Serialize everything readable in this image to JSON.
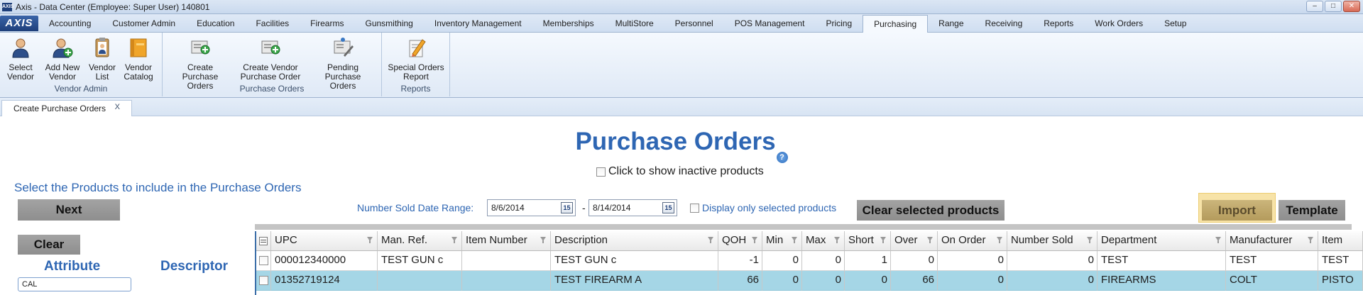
{
  "window": {
    "title": "Axis - Data Center  (Employee: Super User) 140801",
    "app_logo": "AXIS"
  },
  "ribbon": {
    "logo": "AXIS",
    "tabs": [
      "Accounting",
      "Customer Admin",
      "Education",
      "Facilities",
      "Firearms",
      "Gunsmithing",
      "Inventory Management",
      "Memberships",
      "MultiStore",
      "Personnel",
      "POS Management",
      "Pricing",
      "Purchasing",
      "Range",
      "Receiving",
      "Reports",
      "Work Orders",
      "Setup"
    ],
    "active_tab": "Purchasing",
    "groups": [
      {
        "label": "Vendor Admin",
        "buttons": [
          {
            "line1": "Select",
            "line2": "Vendor",
            "icon": "person-icon"
          },
          {
            "line1": "Add New",
            "line2": "Vendor",
            "icon": "person-add-icon"
          },
          {
            "line1": "Vendor",
            "line2": "List",
            "icon": "clipboard-person-icon"
          },
          {
            "line1": "Vendor",
            "line2": "Catalog",
            "icon": "catalog-book-icon"
          }
        ]
      },
      {
        "label": "Purchase Orders",
        "buttons": [
          {
            "line1": "Create Purchase",
            "line2": "Orders",
            "icon": "create-orders-icon"
          },
          {
            "line1": "Create Vendor",
            "line2": "Purchase Order",
            "icon": "vendor-order-icon"
          },
          {
            "line1": "Pending Purchase",
            "line2": "Orders",
            "icon": "pending-orders-icon"
          }
        ]
      },
      {
        "label": "Reports",
        "buttons": [
          {
            "line1": "Special Orders",
            "line2": "Report",
            "icon": "report-pencil-icon"
          }
        ]
      }
    ]
  },
  "doc_tab": {
    "label": "Create Purchase Orders",
    "close": "X"
  },
  "main": {
    "title": "Purchase Orders",
    "help": "?",
    "inactive_label": "Click to show inactive products",
    "instruction": "Select the Products to include in the Purchase Orders",
    "next_label": "Next",
    "date_range_label": "Number Sold Date Range:",
    "date_from": "8/6/2014",
    "date_to": "8/14/2014",
    "date_sep": "-",
    "calendar_glyph": "15",
    "only_selected_label": "Display only selected products",
    "clear_selected_label": "Clear selected products",
    "import_label": "Import",
    "template_label": "Template"
  },
  "filters": {
    "clear_label": "Clear",
    "attribute_header": "Attribute",
    "descriptor_header": "Descriptor",
    "attribute_value": "CAL"
  },
  "grid": {
    "columns": [
      "UPC",
      "Man. Ref.",
      "Item Number",
      "Description",
      "QOH",
      "Min",
      "Max",
      "Short",
      "Over",
      "On Order",
      "Number Sold",
      "Department",
      "Manufacturer",
      "Item"
    ],
    "rows": [
      {
        "upc": "000012340000",
        "man_ref": "TEST GUN c",
        "item_number": "",
        "description": "TEST GUN c",
        "qoh": "-1",
        "min": "0",
        "max": "0",
        "short": "1",
        "over": "0",
        "on_order": "0",
        "number_sold": "0",
        "department": "TEST",
        "manufacturer": "TEST",
        "item": "TEST"
      },
      {
        "upc": "01352719124",
        "man_ref": "",
        "item_number": "",
        "description": "TEST FIREARM A",
        "qoh": "66",
        "min": "0",
        "max": "0",
        "short": "0",
        "over": "66",
        "on_order": "0",
        "number_sold": "0",
        "department": "FIREARMS",
        "manufacturer": "COLT",
        "item": "PISTO"
      }
    ]
  }
}
